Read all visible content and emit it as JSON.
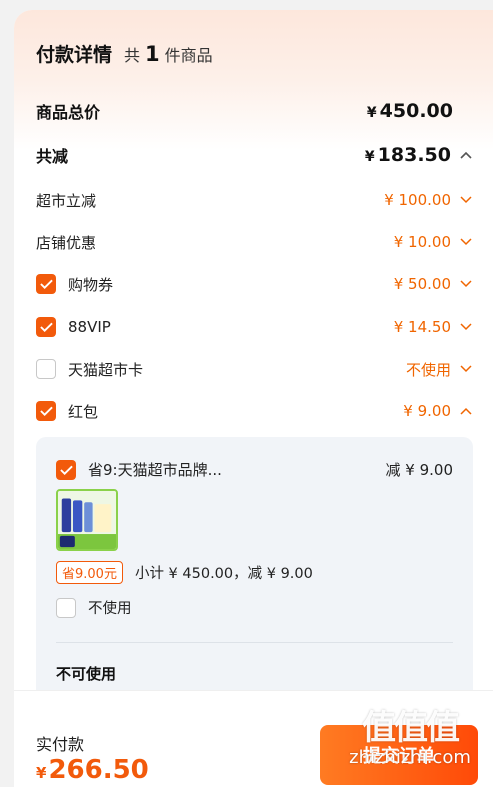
{
  "header": {
    "title": "付款详情",
    "count_prefix": "共",
    "count": "1",
    "count_suffix": "件商品"
  },
  "summary": {
    "total_label": "商品总价",
    "total_currency": "¥",
    "total_value": "450.00",
    "discount_label": "共减",
    "discount_currency": "¥",
    "discount_value": "183.50"
  },
  "discounts": [
    {
      "label": "超市立减",
      "value": "¥ 100.00",
      "checkbox": null
    },
    {
      "label": "店铺优惠",
      "value": "¥ 10.00",
      "checkbox": null
    },
    {
      "label": "购物券",
      "value": "¥ 50.00",
      "checkbox": true
    },
    {
      "label": "88VIP",
      "value": "¥ 14.50",
      "checkbox": true
    },
    {
      "label": "天猫超市卡",
      "value": "不使用",
      "checkbox": false
    },
    {
      "label": "红包",
      "value": "¥ 9.00",
      "checkbox": true
    }
  ],
  "coupon": {
    "title": "省9:天猫超市品牌...",
    "minus_text": "减 ¥ 9.00",
    "tag": "省9.00元",
    "subtotal": "小计 ¥ 450.00，减 ¥ 9.00",
    "no_use_label": "不使用",
    "unavailable_label": "不可使用"
  },
  "footer": {
    "pay_label": "实付款",
    "pay_currency": "¥",
    "pay_value": "266.50",
    "submit_label": "提交订单"
  },
  "watermark": {
    "big": "值值值",
    "small": "zhizhizhi.com"
  },
  "colors": {
    "accent": "#f25a0b",
    "orange_text": "#f06500",
    "panel_bg": "#f1f4f8"
  }
}
